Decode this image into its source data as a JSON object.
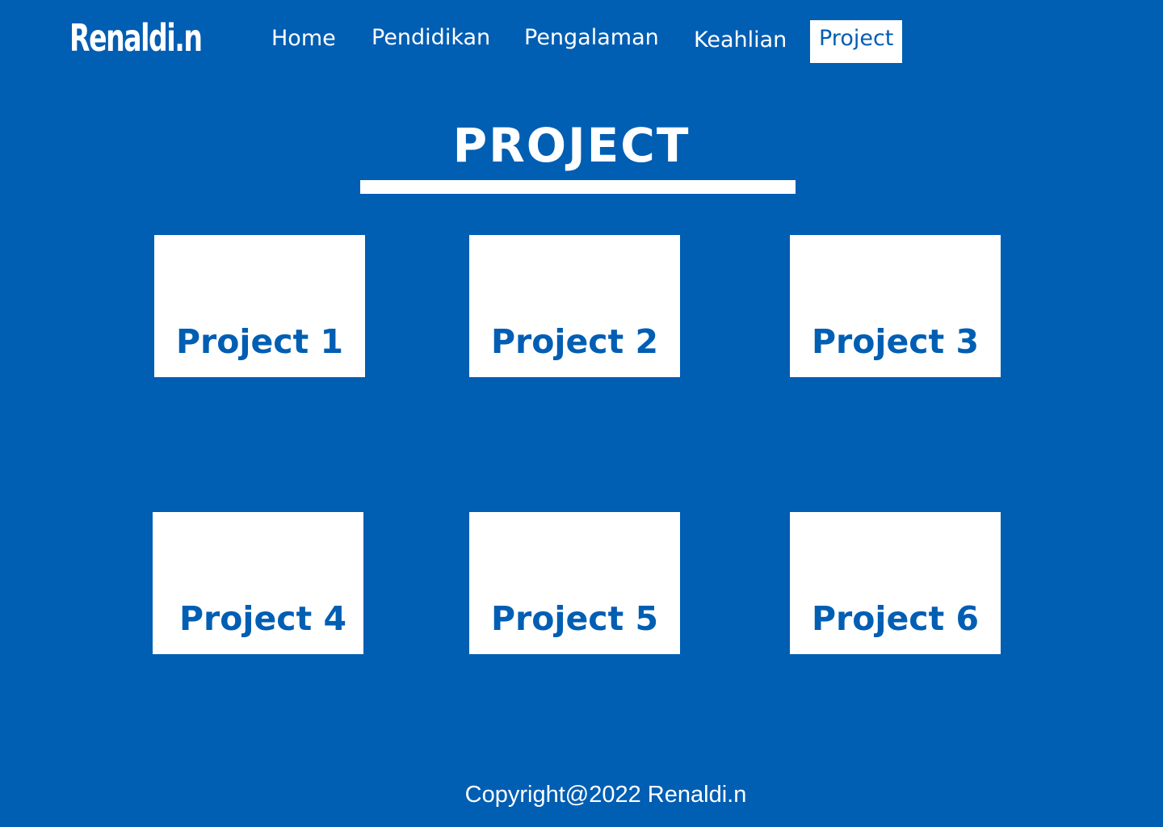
{
  "brand": {
    "logo_text": "Renaldi.n"
  },
  "nav": {
    "items": [
      {
        "label": "Home",
        "active": false
      },
      {
        "label": "Pendidikan",
        "active": false
      },
      {
        "label": "Pengalaman",
        "active": false
      },
      {
        "label": "Keahlian",
        "active": false
      },
      {
        "label": "Project",
        "active": true
      }
    ]
  },
  "main": {
    "title": "PROJECT",
    "projects": [
      {
        "label": "Project 1"
      },
      {
        "label": "Project 2"
      },
      {
        "label": "Project 3"
      },
      {
        "label": "Project 4"
      },
      {
        "label": "Project 5"
      },
      {
        "label": "Project 6"
      }
    ]
  },
  "footer": {
    "text": "Copyright@2022 Renaldi.n"
  },
  "colors": {
    "background": "#005eb3",
    "card": "#ffffff",
    "accent_text": "#005eb3"
  }
}
